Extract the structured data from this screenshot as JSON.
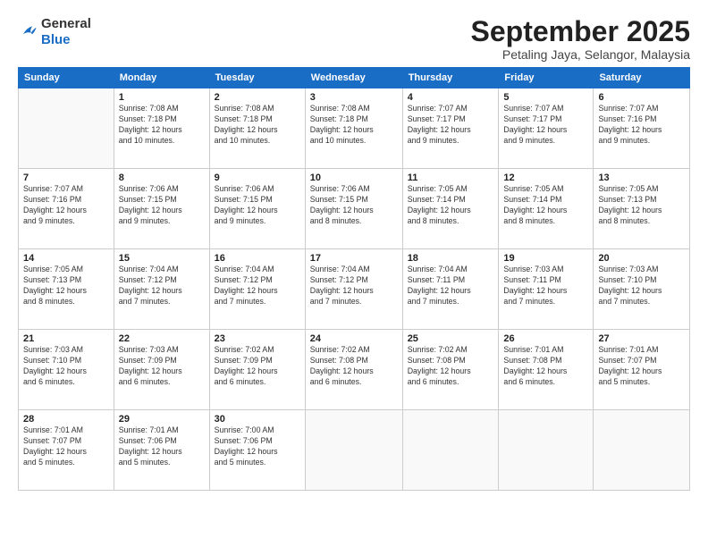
{
  "logo": {
    "general": "General",
    "blue": "Blue"
  },
  "header": {
    "month_year": "September 2025",
    "location": "Petaling Jaya, Selangor, Malaysia"
  },
  "weekdays": [
    "Sunday",
    "Monday",
    "Tuesday",
    "Wednesday",
    "Thursday",
    "Friday",
    "Saturday"
  ],
  "weeks": [
    [
      {
        "day": "",
        "info": ""
      },
      {
        "day": "1",
        "info": "Sunrise: 7:08 AM\nSunset: 7:18 PM\nDaylight: 12 hours\nand 10 minutes."
      },
      {
        "day": "2",
        "info": "Sunrise: 7:08 AM\nSunset: 7:18 PM\nDaylight: 12 hours\nand 10 minutes."
      },
      {
        "day": "3",
        "info": "Sunrise: 7:08 AM\nSunset: 7:18 PM\nDaylight: 12 hours\nand 10 minutes."
      },
      {
        "day": "4",
        "info": "Sunrise: 7:07 AM\nSunset: 7:17 PM\nDaylight: 12 hours\nand 9 minutes."
      },
      {
        "day": "5",
        "info": "Sunrise: 7:07 AM\nSunset: 7:17 PM\nDaylight: 12 hours\nand 9 minutes."
      },
      {
        "day": "6",
        "info": "Sunrise: 7:07 AM\nSunset: 7:16 PM\nDaylight: 12 hours\nand 9 minutes."
      }
    ],
    [
      {
        "day": "7",
        "info": "Sunrise: 7:07 AM\nSunset: 7:16 PM\nDaylight: 12 hours\nand 9 minutes."
      },
      {
        "day": "8",
        "info": "Sunrise: 7:06 AM\nSunset: 7:15 PM\nDaylight: 12 hours\nand 9 minutes."
      },
      {
        "day": "9",
        "info": "Sunrise: 7:06 AM\nSunset: 7:15 PM\nDaylight: 12 hours\nand 9 minutes."
      },
      {
        "day": "10",
        "info": "Sunrise: 7:06 AM\nSunset: 7:15 PM\nDaylight: 12 hours\nand 8 minutes."
      },
      {
        "day": "11",
        "info": "Sunrise: 7:05 AM\nSunset: 7:14 PM\nDaylight: 12 hours\nand 8 minutes."
      },
      {
        "day": "12",
        "info": "Sunrise: 7:05 AM\nSunset: 7:14 PM\nDaylight: 12 hours\nand 8 minutes."
      },
      {
        "day": "13",
        "info": "Sunrise: 7:05 AM\nSunset: 7:13 PM\nDaylight: 12 hours\nand 8 minutes."
      }
    ],
    [
      {
        "day": "14",
        "info": "Sunrise: 7:05 AM\nSunset: 7:13 PM\nDaylight: 12 hours\nand 8 minutes."
      },
      {
        "day": "15",
        "info": "Sunrise: 7:04 AM\nSunset: 7:12 PM\nDaylight: 12 hours\nand 7 minutes."
      },
      {
        "day": "16",
        "info": "Sunrise: 7:04 AM\nSunset: 7:12 PM\nDaylight: 12 hours\nand 7 minutes."
      },
      {
        "day": "17",
        "info": "Sunrise: 7:04 AM\nSunset: 7:12 PM\nDaylight: 12 hours\nand 7 minutes."
      },
      {
        "day": "18",
        "info": "Sunrise: 7:04 AM\nSunset: 7:11 PM\nDaylight: 12 hours\nand 7 minutes."
      },
      {
        "day": "19",
        "info": "Sunrise: 7:03 AM\nSunset: 7:11 PM\nDaylight: 12 hours\nand 7 minutes."
      },
      {
        "day": "20",
        "info": "Sunrise: 7:03 AM\nSunset: 7:10 PM\nDaylight: 12 hours\nand 7 minutes."
      }
    ],
    [
      {
        "day": "21",
        "info": "Sunrise: 7:03 AM\nSunset: 7:10 PM\nDaylight: 12 hours\nand 6 minutes."
      },
      {
        "day": "22",
        "info": "Sunrise: 7:03 AM\nSunset: 7:09 PM\nDaylight: 12 hours\nand 6 minutes."
      },
      {
        "day": "23",
        "info": "Sunrise: 7:02 AM\nSunset: 7:09 PM\nDaylight: 12 hours\nand 6 minutes."
      },
      {
        "day": "24",
        "info": "Sunrise: 7:02 AM\nSunset: 7:08 PM\nDaylight: 12 hours\nand 6 minutes."
      },
      {
        "day": "25",
        "info": "Sunrise: 7:02 AM\nSunset: 7:08 PM\nDaylight: 12 hours\nand 6 minutes."
      },
      {
        "day": "26",
        "info": "Sunrise: 7:01 AM\nSunset: 7:08 PM\nDaylight: 12 hours\nand 6 minutes."
      },
      {
        "day": "27",
        "info": "Sunrise: 7:01 AM\nSunset: 7:07 PM\nDaylight: 12 hours\nand 5 minutes."
      }
    ],
    [
      {
        "day": "28",
        "info": "Sunrise: 7:01 AM\nSunset: 7:07 PM\nDaylight: 12 hours\nand 5 minutes."
      },
      {
        "day": "29",
        "info": "Sunrise: 7:01 AM\nSunset: 7:06 PM\nDaylight: 12 hours\nand 5 minutes."
      },
      {
        "day": "30",
        "info": "Sunrise: 7:00 AM\nSunset: 7:06 PM\nDaylight: 12 hours\nand 5 minutes."
      },
      {
        "day": "",
        "info": ""
      },
      {
        "day": "",
        "info": ""
      },
      {
        "day": "",
        "info": ""
      },
      {
        "day": "",
        "info": ""
      }
    ]
  ]
}
